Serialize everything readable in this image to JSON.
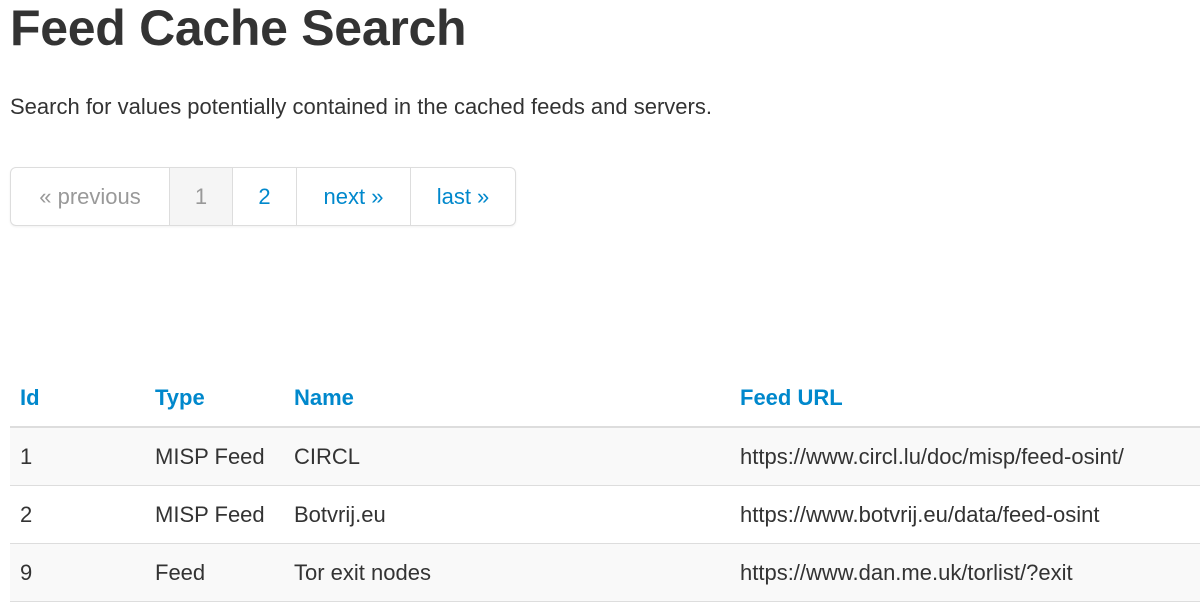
{
  "page": {
    "title": "Feed Cache Search",
    "subtitle": "Search for values potentially contained in the cached feeds and servers."
  },
  "pagination": {
    "previous": "« previous",
    "page1": "1",
    "page2": "2",
    "next": "next »",
    "last": "last »"
  },
  "table": {
    "headers": {
      "id": "Id",
      "type": "Type",
      "name": "Name",
      "url": "Feed URL"
    },
    "rows": [
      {
        "id": "1",
        "type": "MISP Feed",
        "name": "CIRCL",
        "url": "https://www.circl.lu/doc/misp/feed-osint/"
      },
      {
        "id": "2",
        "type": "MISP Feed",
        "name": "Botvrij.eu",
        "url": "https://www.botvrij.eu/data/feed-osint"
      },
      {
        "id": "9",
        "type": "Feed",
        "name": "Tor exit nodes",
        "url": "https://www.dan.me.uk/torlist/?exit"
      }
    ]
  },
  "colors": {
    "link": "#0088cc",
    "text": "#333333",
    "muted": "#999999",
    "border": "#dddddd",
    "stripe": "#f9f9f9"
  }
}
